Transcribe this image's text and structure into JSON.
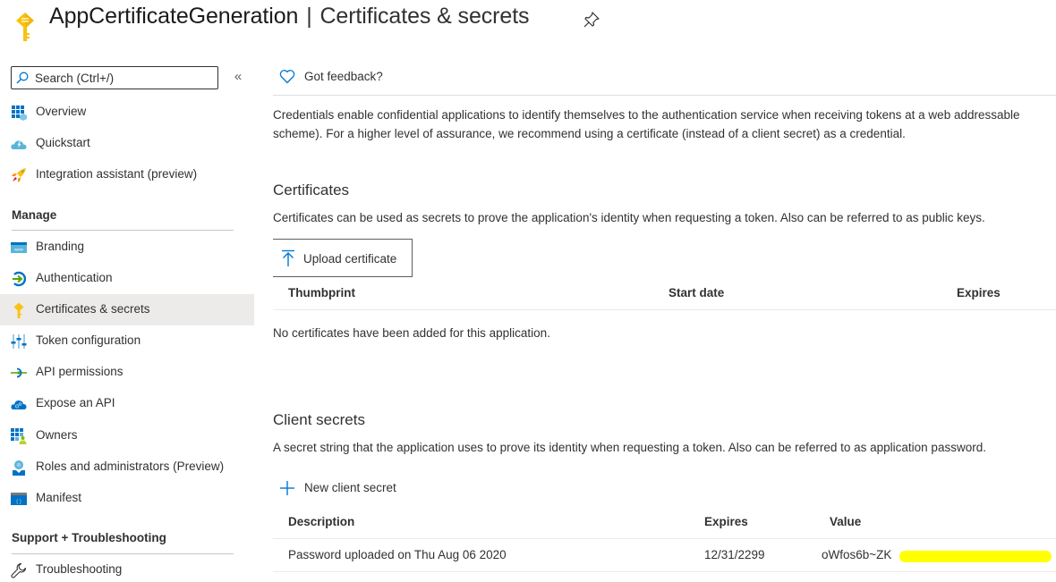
{
  "header": {
    "app_name": "AppCertificateGeneration",
    "separator": "|",
    "page_name": "Certificates & secrets",
    "icon": "key-icon",
    "pin_icon": "pin-icon"
  },
  "sidebar": {
    "search": {
      "placeholder": "Search (Ctrl+/)",
      "value": "",
      "icon": "search-icon"
    },
    "collapse_label": "«",
    "top_items": [
      {
        "label": "Overview",
        "icon": "overview-grid-icon"
      },
      {
        "label": "Quickstart",
        "icon": "quickstart-cloud-icon"
      },
      {
        "label": "Integration assistant (preview)",
        "icon": "rocket-icon"
      }
    ],
    "manage_section": {
      "title": "Manage",
      "items": [
        {
          "label": "Branding",
          "icon": "branding-www-icon"
        },
        {
          "label": "Authentication",
          "icon": "authentication-icon"
        },
        {
          "label": "Certificates & secrets",
          "icon": "key-icon",
          "active": true
        },
        {
          "label": "Token configuration",
          "icon": "token-sliders-icon"
        },
        {
          "label": "API permissions",
          "icon": "api-permissions-icon"
        },
        {
          "label": "Expose an API",
          "icon": "expose-api-cloud-icon"
        },
        {
          "label": "Owners",
          "icon": "owners-icon"
        },
        {
          "label": "Roles and administrators (Preview)",
          "icon": "roles-icon"
        },
        {
          "label": "Manifest",
          "icon": "manifest-icon"
        }
      ]
    },
    "support_section": {
      "title": "Support + Troubleshooting",
      "items": [
        {
          "label": "Troubleshooting",
          "icon": "wrench-icon"
        }
      ]
    }
  },
  "main": {
    "feedback_label": "Got feedback?",
    "intro_line1": "Credentials enable confidential applications to identify themselves to the authentication service when receiving tokens at a web addressable",
    "intro_line2": "scheme). For a higher level of assurance, we recommend using a certificate (instead of a client secret) as a credential.",
    "certificates": {
      "title": "Certificates",
      "description": "Certificates can be used as secrets to prove the application's identity when requesting a token. Also can be referred to as public keys.",
      "upload_label": "Upload certificate",
      "columns": [
        "Thumbprint",
        "Start date",
        "Expires"
      ],
      "empty_message": "No certificates have been added for this application."
    },
    "client_secrets": {
      "title": "Client secrets",
      "description": "A secret string that the application uses to prove its identity when requesting a token. Also can be referred to as application password.",
      "new_label": "New client secret",
      "columns": [
        "Description",
        "Expires",
        "Value"
      ],
      "rows": [
        {
          "description": "Password uploaded on Thu Aug 06 2020",
          "expires": "12/31/2299",
          "value": "oWfos6b~ZK",
          "value_redacted": true
        }
      ]
    }
  },
  "colors": {
    "accent": "#0078d4",
    "key_yellow": "#f8c213",
    "active_bg": "#edebe9",
    "redaction": "#ffff00"
  }
}
